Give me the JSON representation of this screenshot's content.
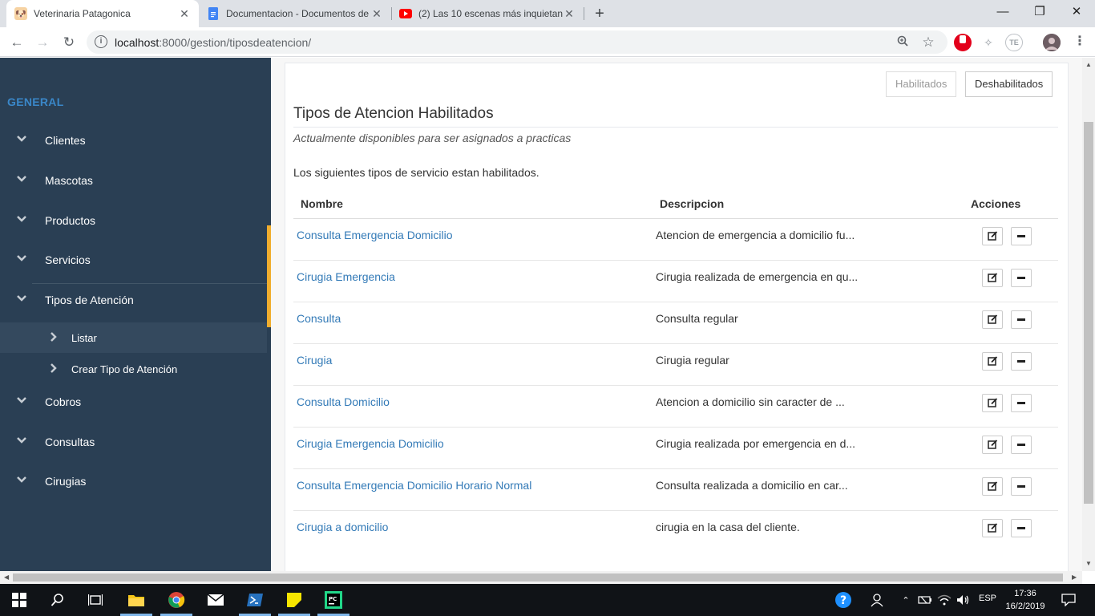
{
  "browser": {
    "tabs": [
      {
        "title": "Veterinaria Patagonica",
        "active": true,
        "icon": "dog-favicon-icon"
      },
      {
        "title": "Documentacion - Documentos de",
        "active": false,
        "icon": "google-docs-icon"
      },
      {
        "title": "(2) Las 10 escenas más inquietant",
        "active": false,
        "icon": "youtube-icon"
      }
    ],
    "close_glyph": "✕",
    "new_tab_glyph": "+",
    "url_host": "localhost",
    "url_rest": ":8000/gestion/tiposdeatencion/",
    "ext_te": "TE"
  },
  "sidebar": {
    "section": "GENERAL",
    "items": [
      {
        "label": "Clientes"
      },
      {
        "label": "Mascotas"
      },
      {
        "label": "Productos"
      },
      {
        "label": "Servicios"
      },
      {
        "label": "Tipos de Atención"
      },
      {
        "label": "Cobros"
      },
      {
        "label": "Consultas"
      },
      {
        "label": "Cirugias"
      }
    ],
    "subitems": [
      {
        "label": "Listar"
      },
      {
        "label": "Crear Tipo de Atención"
      }
    ]
  },
  "main": {
    "btn_enabled": "Habilitados",
    "btn_disabled": "Deshabilitados",
    "title": "Tipos de Atencion Habilitados",
    "subtitle": "Actualmente disponibles para ser asignados a practicas",
    "intro": "Los siguientes tipos de servicio estan habilitados.",
    "table": {
      "headers": {
        "name": "Nombre",
        "desc": "Descripcion",
        "actions": "Acciones"
      },
      "rows": [
        {
          "name": "Consulta Emergencia Domicilio",
          "desc": "Atencion de emergencia a domicilio fu..."
        },
        {
          "name": "Cirugia Emergencia",
          "desc": "Cirugia realizada de emergencia en qu..."
        },
        {
          "name": "Consulta",
          "desc": "Consulta regular"
        },
        {
          "name": "Cirugia",
          "desc": "Cirugia regular"
        },
        {
          "name": "Consulta Domicilio",
          "desc": "Atencion a domicilio sin caracter de ..."
        },
        {
          "name": "Cirugia Emergencia Domicilio",
          "desc": "Cirugia realizada por emergencia en d..."
        },
        {
          "name": "Consulta Emergencia Domicilio Horario Normal",
          "desc": "Consulta realizada a domicilio en car..."
        },
        {
          "name": "Cirugia a domicilio",
          "desc": "cirugia en la casa del cliente."
        }
      ]
    }
  },
  "taskbar": {
    "lang": "ESP",
    "time": "17:36",
    "date": "16/2/2019"
  },
  "colors": {
    "sidebar_bg": "#2a3f54",
    "accent_bar": "#f0ad2e",
    "link": "#337ab7",
    "section": "#3a87c8"
  }
}
